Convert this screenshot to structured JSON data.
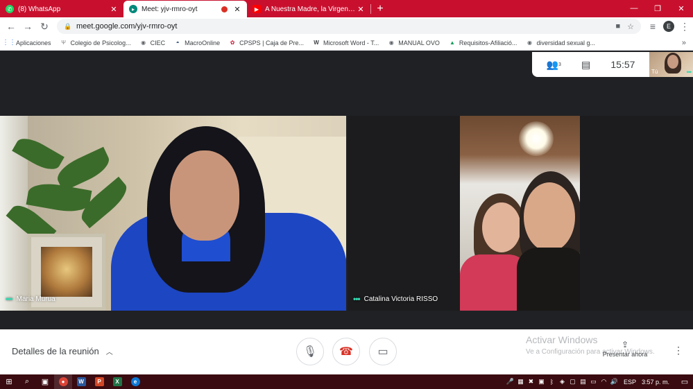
{
  "browser": {
    "tabs": [
      {
        "label": "(8) WhatsApp",
        "favicon": "whatsapp-icon",
        "color": "#25d366"
      },
      {
        "label": "Meet: yjv-rmro-oyt",
        "favicon": "meet-icon",
        "color": "#00897b"
      },
      {
        "label": "A Nuestra Madre, la Virgen del H",
        "favicon": "youtube-icon",
        "color": "#ff0000"
      }
    ],
    "close_glyph": "✕",
    "new_tab_glyph": "+",
    "window_controls": {
      "minimize": "—",
      "restore": "❐",
      "close": "✕"
    },
    "url": "meet.google.com/yjv-rmro-oyt",
    "profile_initial": "E",
    "bookmarks": [
      {
        "label": "Aplicaciones"
      },
      {
        "label": "Colegio de Psicolog..."
      },
      {
        "label": "CIEC"
      },
      {
        "label": "MacroOnline"
      },
      {
        "label": "CPSPS | Caja de Pre..."
      },
      {
        "label": "Microsoft Word - T..."
      },
      {
        "label": "MANUAL OVO"
      },
      {
        "label": "Requisitos-Afiliació..."
      },
      {
        "label": "diversidad sexual g..."
      }
    ],
    "bookmarks_more": "»"
  },
  "meet": {
    "participants_count": "3",
    "clock": "15:57",
    "self_label": "Tú",
    "tiles": [
      {
        "name": "Maria Murua"
      },
      {
        "name": "Catalina Victoria RISSO"
      }
    ],
    "active_dots": "•••",
    "details_label": "Detalles de la reunión",
    "present_label": "Presentar ahora",
    "activate_windows_title": "Activar Windows",
    "activate_windows_sub": "Ve a Configuración para activar Windows.",
    "accent_color": "#34d8b0",
    "end_call_color": "#d93025"
  },
  "taskbar": {
    "language": "ESP",
    "time": "3:57 p. m.",
    "accent": "#3a0b10"
  }
}
